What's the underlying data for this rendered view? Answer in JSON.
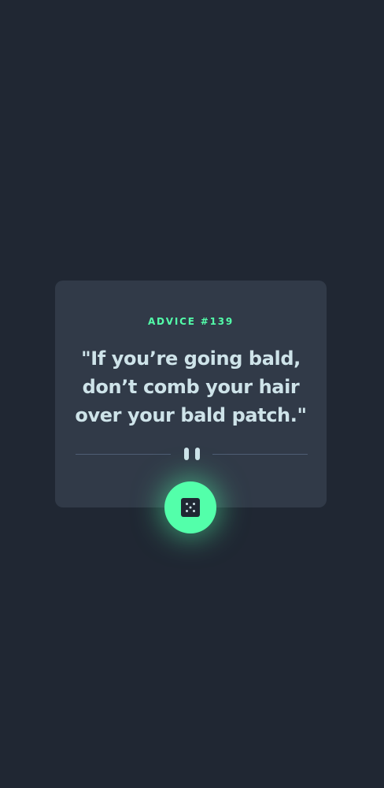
{
  "advice": {
    "id_label": "ADVICE #139",
    "quote": "\"If you’re going bald, don’t comb your hair over your bald patch.\""
  },
  "icons": {
    "divider": "pause-icon",
    "button": "dice-icon"
  },
  "colors": {
    "background": "#202733",
    "card": "#313A48",
    "accent": "#53FFAA",
    "text": "#CEE3E9",
    "divider_line": "#4F5D74"
  }
}
